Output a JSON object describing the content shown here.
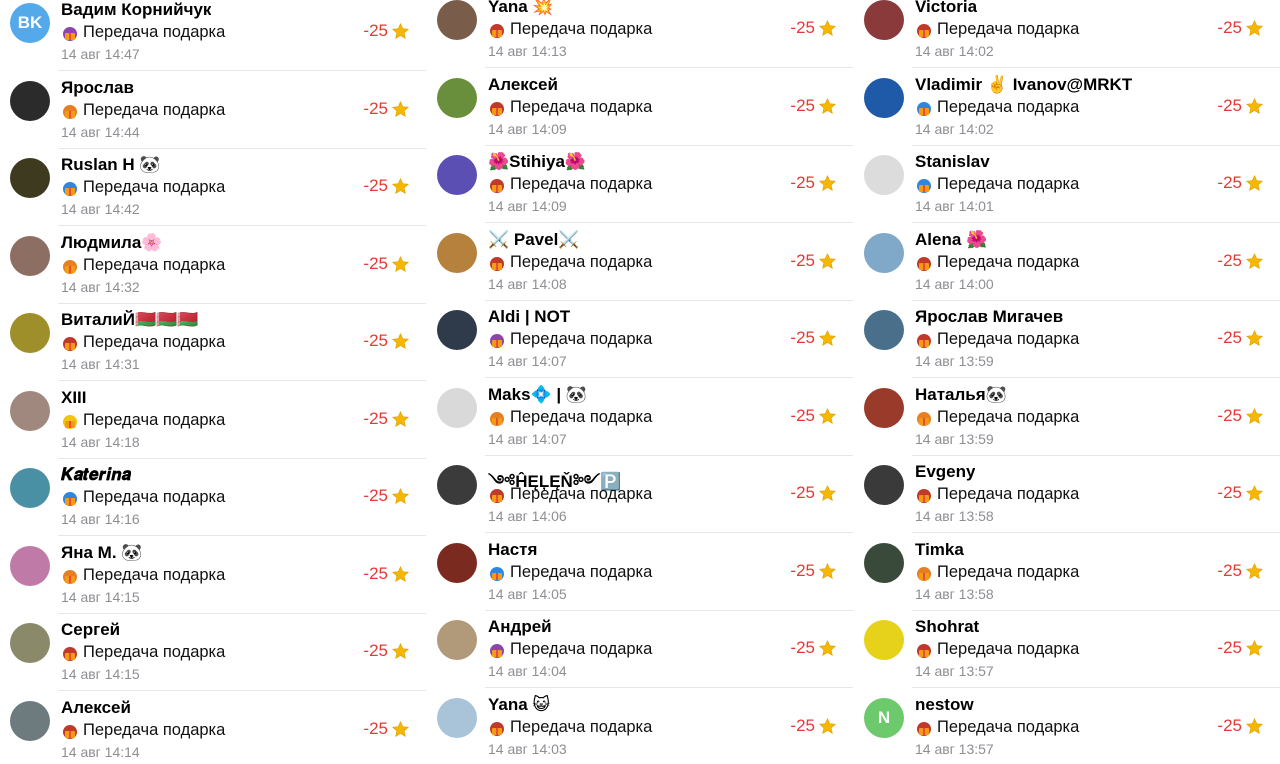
{
  "common": {
    "description": "Передача подарка",
    "amount": "-25"
  },
  "columns": [
    [
      {
        "name": "Вадим Корнийчук",
        "time": "14 авг 14:47",
        "avatar": {
          "initials": "BK",
          "color": "#54a9eb"
        },
        "gift_color": "#8e44ad"
      },
      {
        "name": "Ярослав",
        "time": "14 авг 14:44",
        "avatar": {
          "initials": "",
          "color": "#2b2b2b"
        },
        "gift_color": "#e67e22"
      },
      {
        "name": "Ruslan H 🐼",
        "time": "14 авг 14:42",
        "avatar": {
          "initials": "",
          "color": "#3d3a1f"
        },
        "gift_color": "#2e86de"
      },
      {
        "name": "Людмила🌸",
        "time": "14 авг 14:32",
        "avatar": {
          "initials": "",
          "color": "#8d6e63"
        },
        "gift_color": "#e67e22"
      },
      {
        "name": "ВиталиЙ🇧🇾🇧🇾🇧🇾",
        "time": "14 авг 14:31",
        "avatar": {
          "initials": "",
          "color": "#9e8f2a"
        },
        "gift_color": "#c0392b"
      },
      {
        "name": "XIII",
        "time": "14 авг 14:18",
        "avatar": {
          "initials": "",
          "color": "#a1887f"
        },
        "gift_color": "#f1c40f"
      },
      {
        "name": "𝑲𝒂𝒕𝒆𝒓𝒊𝒏𝒂",
        "time": "14 авг 14:16",
        "avatar": {
          "initials": "",
          "color": "#4a90a4"
        },
        "gift_color": "#2e86de"
      },
      {
        "name": "Яна М. 🐼",
        "time": "14 авг 14:15",
        "avatar": {
          "initials": "",
          "color": "#c07aa8"
        },
        "gift_color": "#e67e22"
      },
      {
        "name": "Сергей",
        "time": "14 авг 14:15",
        "avatar": {
          "initials": "",
          "color": "#8a8a6a"
        },
        "gift_color": "#c0392b"
      },
      {
        "name": "Алексей",
        "time": "14 авг 14:14",
        "avatar": {
          "initials": "",
          "color": "#6d7b7f"
        },
        "gift_color": "#c0392b"
      }
    ],
    [
      {
        "name": "Yana 💥",
        "time": "14 авг 14:13",
        "avatar": {
          "initials": "",
          "color": "#7a5c4a"
        },
        "gift_color": "#c0392b"
      },
      {
        "name": "Алексей",
        "time": "14 авг 14:09",
        "avatar": {
          "initials": "",
          "color": "#6a8f3c"
        },
        "gift_color": "#c0392b"
      },
      {
        "name": "🌺Stihiya🌺",
        "time": "14 авг 14:09",
        "avatar": {
          "initials": "",
          "color": "#5b4fb3"
        },
        "gift_color": "#c0392b"
      },
      {
        "name": "⚔️ Pavel⚔️",
        "time": "14 авг 14:08",
        "avatar": {
          "initials": "",
          "color": "#b5813d"
        },
        "gift_color": "#c0392b"
      },
      {
        "name": "Aldi | NOT",
        "time": "14 авг 14:07",
        "avatar": {
          "initials": "",
          "color": "#2f3b4a"
        },
        "gift_color": "#8e44ad"
      },
      {
        "name": "Maks💠 | 🐼",
        "time": "14 авг 14:07",
        "avatar": {
          "initials": "",
          "color": "#d9d9d9"
        },
        "gift_color": "#e67e22"
      },
      {
        "name": "༺ĤĘĻĘŇ༻🅿️",
        "time": "14 авг 14:06",
        "avatar": {
          "initials": "",
          "color": "#3b3b3b"
        },
        "gift_color": "#c0392b"
      },
      {
        "name": "Настя",
        "time": "14 авг 14:05",
        "avatar": {
          "initials": "",
          "color": "#7b2a20"
        },
        "gift_color": "#2e86de"
      },
      {
        "name": "Андрей",
        "time": "14 авг 14:04",
        "avatar": {
          "initials": "",
          "color": "#b09a7a"
        },
        "gift_color": "#8e44ad"
      },
      {
        "name": "Yana 😺",
        "time": "14 авг 14:03",
        "avatar": {
          "initials": "",
          "color": "#a9c4d9"
        },
        "gift_color": "#c0392b"
      }
    ],
    [
      {
        "name": "Victoria",
        "time": "14 авг 14:02",
        "avatar": {
          "initials": "",
          "color": "#8a3a3a"
        },
        "gift_color": "#c0392b"
      },
      {
        "name": "Vladimir ✌️ Ivanov@MRKT",
        "time": "14 авг 14:02",
        "avatar": {
          "initials": "",
          "color": "#1e5aa8"
        },
        "gift_color": "#2e86de"
      },
      {
        "name": "Stanislav",
        "time": "14 авг 14:01",
        "avatar": {
          "initials": "",
          "color": "#dcdcdc"
        },
        "gift_color": "#2e86de"
      },
      {
        "name": "Alena 🌺",
        "time": "14 авг 14:00",
        "avatar": {
          "initials": "",
          "color": "#7fa8c9"
        },
        "gift_color": "#c0392b"
      },
      {
        "name": "Ярослав Мигачев",
        "time": "14 авг 13:59",
        "avatar": {
          "initials": "",
          "color": "#4a6f8a"
        },
        "gift_color": "#c0392b"
      },
      {
        "name": "Наталья🐼",
        "time": "14 авг 13:59",
        "avatar": {
          "initials": "",
          "color": "#9a3a2a"
        },
        "gift_color": "#e67e22"
      },
      {
        "name": "Evgeny",
        "time": "14 авг 13:58",
        "avatar": {
          "initials": "",
          "color": "#3a3a3a"
        },
        "gift_color": "#c0392b"
      },
      {
        "name": "Timka",
        "time": "14 авг 13:58",
        "avatar": {
          "initials": "",
          "color": "#3a4a3a"
        },
        "gift_color": "#e67e22"
      },
      {
        "name": "Shohrat",
        "time": "14 авг 13:57",
        "avatar": {
          "initials": "",
          "color": "#e6d21a"
        },
        "gift_color": "#c0392b"
      },
      {
        "name": "nestow",
        "time": "14 авг 13:57",
        "avatar": {
          "initials": "N",
          "color": "#6cc96c"
        },
        "gift_color": "#c0392b"
      }
    ]
  ],
  "colors": {
    "amount": "#e53935",
    "star": "#f5b700",
    "divider": "#e5e5ea",
    "time": "#8e8e93"
  },
  "icons": {
    "gift": "gift-sticker-icon",
    "star": "telegram-star-icon"
  }
}
